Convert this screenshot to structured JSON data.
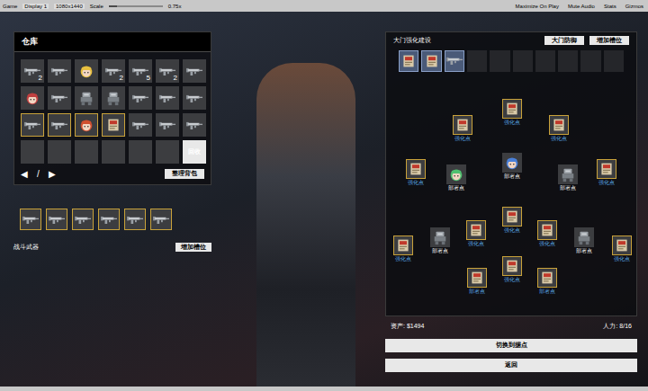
{
  "window": {
    "title": "Game"
  },
  "toolbar": {
    "display": "Display 1",
    "resolution": "1080x1440",
    "scale_label": "Scale",
    "scale_value": "0.75x",
    "scale_level": 0.15,
    "toggles": [
      {
        "label": "Maximize On Play",
        "on": false
      },
      {
        "label": "Mute Audio",
        "on": false
      },
      {
        "label": "Stats",
        "on": false
      },
      {
        "label": "Gizmos",
        "on": false
      }
    ]
  },
  "warehouse": {
    "title": "仓库",
    "items": [
      {
        "kind": "weapon",
        "count": "2",
        "highlighted": false
      },
      {
        "kind": "weapon",
        "highlighted": false
      },
      {
        "kind": "character",
        "color": "#e8c040",
        "highlighted": false
      },
      {
        "kind": "weapon",
        "count": "2",
        "highlighted": false
      },
      {
        "kind": "weapon",
        "count": "5",
        "highlighted": false
      },
      {
        "kind": "weapon",
        "count": "2",
        "highlighted": false
      },
      {
        "kind": "weapon",
        "highlighted": false
      },
      {
        "kind": "character",
        "color": "#c04040",
        "highlighted": false
      },
      {
        "kind": "weapon",
        "highlighted": false
      },
      {
        "kind": "robot",
        "highlighted": false
      },
      {
        "kind": "robot",
        "highlighted": false
      },
      {
        "kind": "weapon",
        "highlighted": false
      },
      {
        "kind": "weapon",
        "highlighted": false
      },
      {
        "kind": "weapon",
        "highlighted": false
      },
      {
        "kind": "weapon",
        "highlighted": true
      },
      {
        "kind": "weapon",
        "highlighted": true
      },
      {
        "kind": "character",
        "color": "#d05030",
        "highlighted": true
      },
      {
        "kind": "card",
        "highlighted": true
      },
      {
        "kind": "weapon",
        "highlighted": false
      },
      {
        "kind": "weapon",
        "highlighted": false
      },
      {
        "kind": "weapon",
        "highlighted": false
      },
      {
        "kind": "empty",
        "highlighted": false
      },
      {
        "kind": "empty",
        "highlighted": false
      },
      {
        "kind": "empty",
        "highlighted": false
      },
      {
        "kind": "empty",
        "highlighted": false
      },
      {
        "kind": "empty",
        "highlighted": false
      },
      {
        "kind": "empty",
        "highlighted": false
      }
    ],
    "recycle_button": "回收",
    "prev": "◀",
    "page": "/",
    "next": "▶",
    "sort_button": "整理背包"
  },
  "loadout": {
    "weapons": [
      {
        "kind": "weapon"
      },
      {
        "kind": "weapon"
      },
      {
        "kind": "weapon"
      },
      {
        "kind": "weapon"
      },
      {
        "kind": "weapon"
      },
      {
        "kind": "weapon"
      }
    ],
    "label": "战斗武器",
    "add_slot_button": "增加槽位"
  },
  "gate": {
    "title": "大门强化建设",
    "buttons": [
      "大门防御",
      "增加槽位"
    ],
    "slots": [
      {
        "kind": "card"
      },
      {
        "kind": "card"
      },
      {
        "kind": "weapon"
      },
      {
        "kind": "empty"
      },
      {
        "kind": "empty"
      },
      {
        "kind": "empty"
      },
      {
        "kind": "empty"
      },
      {
        "kind": "empty"
      },
      {
        "kind": "empty"
      },
      {
        "kind": "empty"
      }
    ],
    "nodes": [
      {
        "label": "强化点",
        "kind": "upgrade"
      },
      {
        "label": "强化点",
        "kind": "upgrade"
      },
      {
        "label": "强化点",
        "kind": "upgrade"
      },
      {
        "label": "强化点",
        "kind": "upgrade"
      },
      {
        "label": "部署点",
        "kind": "character",
        "color": "#50c070"
      },
      {
        "label": "部署点",
        "kind": "character",
        "color": "#4a80d8"
      },
      {
        "label": "部署点",
        "kind": "robot"
      },
      {
        "label": "强化点",
        "kind": "upgrade"
      },
      {
        "label": "强化点",
        "kind": "upgrade"
      },
      {
        "label": "部署点",
        "kind": "robot"
      },
      {
        "label": "强化点",
        "kind": "upgrade"
      },
      {
        "label": "强化点",
        "kind": "upgrade"
      },
      {
        "label": "强化点",
        "kind": "upgrade"
      },
      {
        "label": "部署点",
        "kind": "robot"
      },
      {
        "label": "强化点",
        "kind": "upgrade"
      },
      {
        "label": "部署点",
        "kind": "upgrade"
      },
      {
        "label": "强化点",
        "kind": "upgrade"
      },
      {
        "label": "部署点",
        "kind": "upgrade"
      }
    ]
  },
  "status": {
    "funds": "资产: $1494",
    "manpower": "人力: 8/16"
  },
  "buttons": [
    "切换到据点",
    "返回"
  ]
}
